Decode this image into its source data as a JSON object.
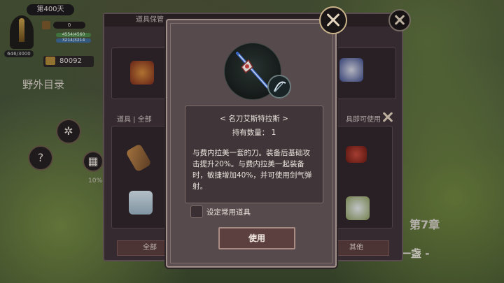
{
  "hud": {
    "day": "第400天",
    "hp": "646/3000",
    "stat1": "0",
    "bar_green": "4554/4560",
    "bar_blue": "3214/3214",
    "gold": "80092",
    "field_title": "野外目录",
    "help": "?",
    "progress_pct": "10%",
    "chapter": "第7章",
    "subtitle": "一盏 -"
  },
  "inventory": {
    "title": "道具保管",
    "tabs_left": "道具 | 全部",
    "tabs_right": "具即可使用",
    "footer_left": "全部",
    "footer_right": "其他"
  },
  "dialog": {
    "item_name": "< 名刀艾斯特拉斯 >",
    "count_label": "持有数量：",
    "count_value": "1",
    "description": "与费内拉美一套的刀。装备后基础攻击提升20%。与费内拉美一起装备时，敏捷增加40%，并可使用剑气弹射。",
    "favorite_label": "设定常用道具",
    "use_button": "使用"
  },
  "icons": {
    "close": "close-x-icon",
    "item": "sword-icon",
    "badge": "scythe-icon"
  }
}
